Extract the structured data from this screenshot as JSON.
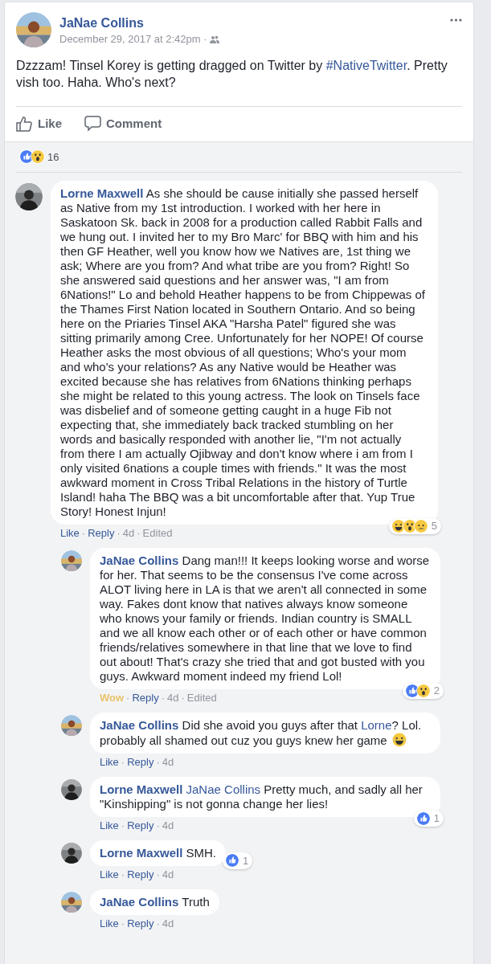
{
  "post": {
    "author": "JaNae Collins",
    "timestamp": "December 29, 2017 at 2:42pm ·",
    "text": "Dzzzam! Tinsel Korey is getting dragged on Twitter by ",
    "hashtag": "#NativeTwitter",
    "text_end": ". Pretty vish too. Haha. Who's next?",
    "actions": [
      {
        "kind": "like",
        "label": "Like"
      },
      {
        "kind": "comment",
        "label": "Comment"
      }
    ],
    "reactions": {
      "icons": [
        {
          "kind": "like"
        },
        {
          "kind": "wow"
        }
      ],
      "count": "16"
    }
  },
  "comments": [
    {
      "author": "Lorne Maxwell",
      "avatar": {
        "kind": "dark"
      },
      "body": [
        {
          "kind": "text",
          "text": "As she should be cause initially she passed herself as Native from my 1st introduction. I worked with her here in Saskatoon Sk. back in 2008 for a production called Rabbit Falls and we hung out. I invited her to my Bro Marc' for BBQ with him and his then GF Heather, well you know how we Natives are, 1st thing we ask; Where are you from? And what tribe are you from? Right! So she answered said questions and her answer was, \"I am from 6Nations!\" Lo and behold Heather happens to be from Chippewas of the Thames First Nation located in Southern Ontario. And so being here on the Priaries Tinsel AKA \"Harsha Patel\" figured she was sitting primarily among Cree. Unfortunately for her NOPE! Of course Heather asks the most obvious of all questions; Who's your mom and who's your relations? As any Native would be Heather was excited because she has relatives from 6Nations thinking perhaps she might be related to this young actress. The look on Tinsels face was disbelief and of someone getting caught in a huge Fib not expecting that, she immediately back tracked stumbling on her words and basically responded with another lie, \"I'm not actually from there I am actually Ojibway and don't know where i am from I only visited 6nations a couple times with friends.\" It was the most awkward moment in Cross Tribal Relations in the history of Turtle Island! haha The BBQ was a bit uncomfortable after that. Yup True Story! Honest Injun!"
        }
      ],
      "actions": [
        {
          "kind": "link",
          "label": "Like"
        },
        {
          "kind": "separator",
          "label": "·"
        },
        {
          "kind": "link",
          "label": "Reply"
        },
        {
          "kind": "separator",
          "label": "·"
        },
        {
          "kind": "meta",
          "label": "4d"
        },
        {
          "kind": "separator",
          "label": "·"
        },
        {
          "kind": "meta",
          "label": "Edited"
        }
      ],
      "reactions": {
        "icons": [
          {
            "kind": "haha"
          },
          {
            "kind": "wow"
          },
          {
            "kind": "sad"
          }
        ],
        "count": "5"
      },
      "children": [
        {
          "author": "JaNae Collins",
          "avatar": {
            "kind": "light"
          },
          "body": [
            {
              "kind": "text",
              "text": "Dang man!!! It keeps looking worse and worse for her. That seems to be the consensus I've come across ALOT living here in LA is that we aren't all connected in some way. Fakes dont know that natives always know someone who knows your family or friends. Indian country is SMALL and we all know each other or of each other or have common friends/relatives somewhere in that line that we love to find out about! That's crazy she tried that and got busted with you guys. Awkward moment indeed my friend Lol!"
            }
          ],
          "actions": [
            {
              "kind": "reacted",
              "label": "Wow"
            },
            {
              "kind": "separator",
              "label": "·"
            },
            {
              "kind": "link",
              "label": "Reply"
            },
            {
              "kind": "separator",
              "label": "·"
            },
            {
              "kind": "meta",
              "label": "4d"
            },
            {
              "kind": "separator",
              "label": "·"
            },
            {
              "kind": "meta",
              "label": "Edited"
            }
          ],
          "reactions": {
            "icons": [
              {
                "kind": "like"
              },
              {
                "kind": "wow"
              }
            ],
            "count": "2"
          }
        },
        {
          "author": "JaNae Collins",
          "avatar": {
            "kind": "light"
          },
          "body": [
            {
              "kind": "text",
              "text": "Did she avoid you guys after that "
            },
            {
              "kind": "mention",
              "text": "Lorne"
            },
            {
              "kind": "text",
              "text": "? Lol. probably all shamed out cuz you guys knew her game "
            },
            {
              "kind": "emoji"
            }
          ],
          "actions": [
            {
              "kind": "link",
              "label": "Like"
            },
            {
              "kind": "separator",
              "label": "·"
            },
            {
              "kind": "link",
              "label": "Reply"
            },
            {
              "kind": "separator",
              "label": "·"
            },
            {
              "kind": "meta",
              "label": "4d"
            }
          ]
        },
        {
          "author": "Lorne Maxwell",
          "avatar": {
            "kind": "dark"
          },
          "body": [
            {
              "kind": "mention",
              "text": "JaNae Collins"
            },
            {
              "kind": "text",
              "text": " Pretty much, and sadly all her \"Kinshipping\" is not gonna change her lies!"
            }
          ],
          "actions": [
            {
              "kind": "link",
              "label": "Like"
            },
            {
              "kind": "separator",
              "label": "·"
            },
            {
              "kind": "link",
              "label": "Reply"
            },
            {
              "kind": "separator",
              "label": "·"
            },
            {
              "kind": "meta",
              "label": "4d"
            }
          ],
          "reactions": {
            "icons": [
              {
                "kind": "like"
              }
            ],
            "count": "1"
          }
        },
        {
          "author": "Lorne Maxwell",
          "avatar": {
            "kind": "dark"
          },
          "body": [
            {
              "kind": "text",
              "text": "SMH."
            }
          ],
          "actions": [
            {
              "kind": "link",
              "label": "Like"
            },
            {
              "kind": "separator",
              "label": "·"
            },
            {
              "kind": "link",
              "label": "Reply"
            },
            {
              "kind": "separator",
              "label": "·"
            },
            {
              "kind": "meta",
              "label": "4d"
            }
          ],
          "reactions": {
            "icons": [
              {
                "kind": "like"
              }
            ],
            "count": "1"
          },
          "inline_reactions": true
        },
        {
          "author": "JaNae Collins",
          "avatar": {
            "kind": "light"
          },
          "body": [
            {
              "kind": "text",
              "text": "Truth"
            }
          ],
          "actions": [
            {
              "kind": "link",
              "label": "Like"
            },
            {
              "kind": "separator",
              "label": "·"
            },
            {
              "kind": "link",
              "label": "Reply"
            },
            {
              "kind": "separator",
              "label": "·"
            },
            {
              "kind": "meta",
              "label": "4d"
            }
          ]
        }
      ]
    }
  ]
}
